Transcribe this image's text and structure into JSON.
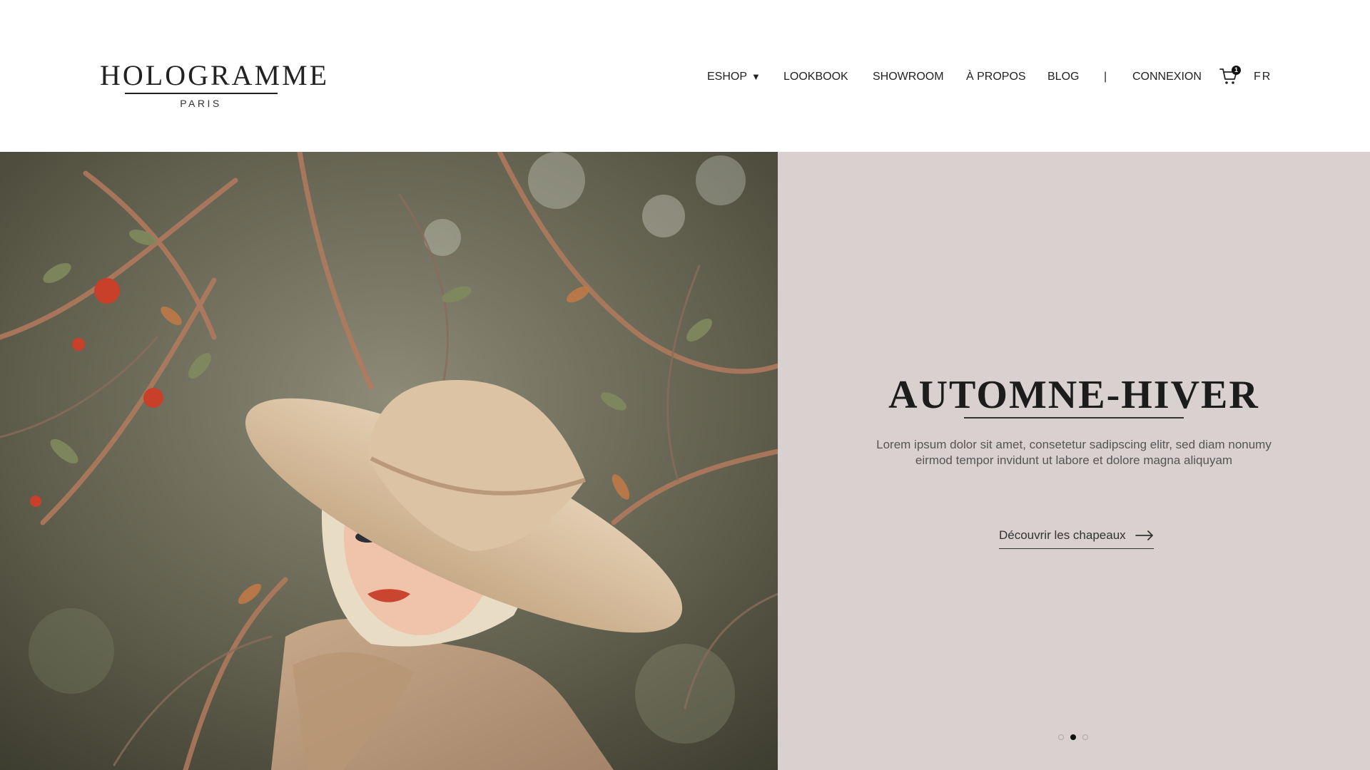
{
  "brand": {
    "name": "HOLOGRAMME",
    "city": "PARIS"
  },
  "nav": {
    "items": [
      {
        "label": "ESHOP",
        "caret": "▼"
      },
      {
        "label": "LOOKBOOK"
      },
      {
        "label": "SHOWROOM"
      },
      {
        "label": "À PROPOS"
      },
      {
        "label": "BLOG"
      }
    ],
    "separator": "|",
    "login": "CONNEXION",
    "cart_count": "1",
    "language": "FR"
  },
  "hero": {
    "title": "AUTOMNE-HIVER",
    "text": "Lorem ipsum dolor sit amet, consetetur sadipscing elitr, sed diam nonumy eirmod tempor invidunt ut labore et dolore magna aliquyam",
    "cta_label": "Découvrir les chapeaux",
    "slides": 3,
    "active_slide": 2
  },
  "colors": {
    "panel_background": "#d9d0d0",
    "text_dark": "#222222",
    "text_muted": "#555555"
  },
  "icons": [
    "cart-icon",
    "chevron-down-icon",
    "arrow-right-icon"
  ]
}
